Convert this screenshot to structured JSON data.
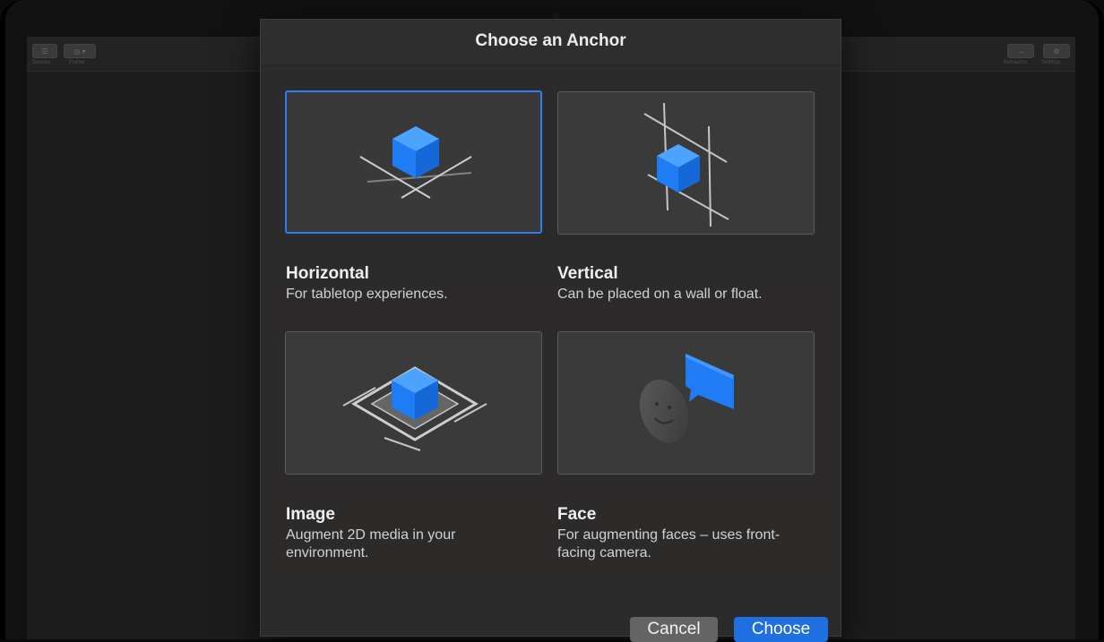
{
  "toolbar": {
    "left_labels": [
      "Scenes",
      "Frame"
    ],
    "right_labels": [
      "Behaviors",
      "Settings"
    ]
  },
  "dialog": {
    "title": "Choose an Anchor",
    "options": [
      {
        "title": "Horizontal",
        "description": "For tabletop experiences.",
        "selected": true,
        "icon": "horizontal-anchor-icon"
      },
      {
        "title": "Vertical",
        "description": "Can be placed on a wall or float.",
        "selected": false,
        "icon": "vertical-anchor-icon"
      },
      {
        "title": "Image",
        "description": "Augment 2D media in your environment.",
        "selected": false,
        "icon": "image-anchor-icon"
      },
      {
        "title": "Face",
        "description": "For augmenting faces – uses front-facing camera.",
        "selected": false,
        "icon": "face-anchor-icon"
      }
    ],
    "cancel_label": "Cancel",
    "choose_label": "Choose"
  },
  "colors": {
    "accent": "#2d7ff0",
    "cube_blue": "#1f7cf5",
    "dialog_bg": "#2b2b2b",
    "tile_bg": "#3a3a3a"
  }
}
